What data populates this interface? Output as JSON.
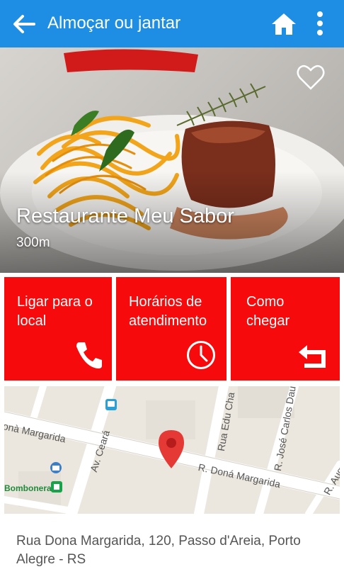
{
  "appbar": {
    "title": "Almoçar ou jantar",
    "back_icon": "arrow-left-icon",
    "home_icon": "home-icon",
    "more_icon": "more-vertical-icon",
    "color": "#1d8ee3"
  },
  "restaurant": {
    "name": "Restaurante Meu Sabor",
    "distance": "300m",
    "favorite_icon": "heart-outline-icon"
  },
  "actions": [
    {
      "label": "Ligar para o local",
      "icon": "phone-icon"
    },
    {
      "label": "Horários de atendimento",
      "icon": "clock-icon"
    },
    {
      "label": "Como chegar",
      "icon": "return-arrow-icon"
    }
  ],
  "action_color": "#f60a0c",
  "map": {
    "streets": [
      "onà Margarida",
      "Av. Ceará",
      "Rua Edu Cha",
      "R. José Carlos Dauc",
      "R. Doná Margarida",
      "R. August"
    ],
    "poi": "Bombonera",
    "pin_icon": "map-pin-icon"
  },
  "address": "Rua Dona Margarida, 120, Passo d'Areia, Porto Alegre - RS"
}
